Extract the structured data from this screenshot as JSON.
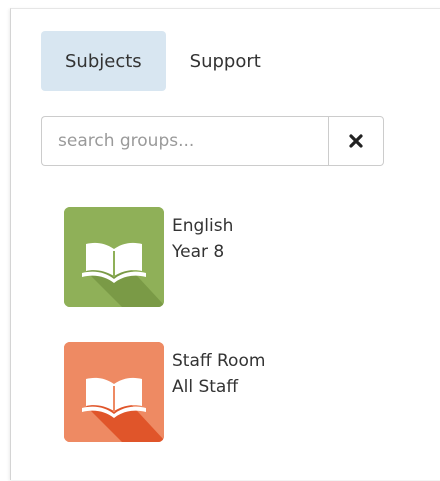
{
  "tabs": [
    {
      "label": "Subjects",
      "active": true
    },
    {
      "label": "Support",
      "active": false
    }
  ],
  "search": {
    "placeholder": "search groups...",
    "value": "",
    "clear_icon": "close-icon"
  },
  "groups": [
    {
      "name": "English",
      "subtitle": "Year 8",
      "icon": "book-icon",
      "color": "#8fb058"
    },
    {
      "name": "Staff Room",
      "subtitle": "All Staff",
      "icon": "book-icon",
      "color": "#ea6a3c"
    }
  ]
}
